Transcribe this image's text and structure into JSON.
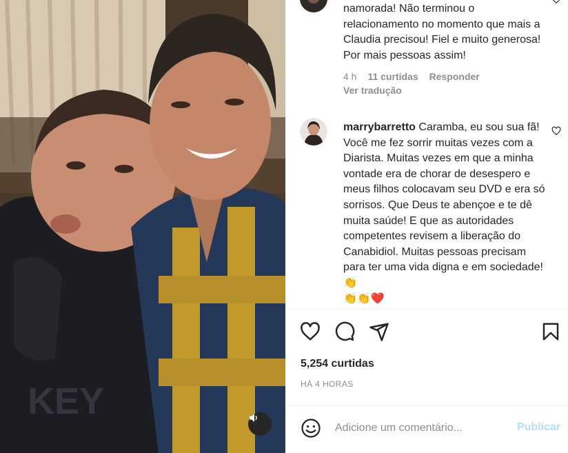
{
  "media": {
    "mute_icon": "speaker-icon"
  },
  "comments": [
    {
      "username": "",
      "text": "namorada! Não terminou o relacionamento no momento que mais a Claudia precisou! Fiel e muito generosa! Por mais pessoas assim!",
      "time": "4 h",
      "likes": "11 curtidas",
      "reply": "Responder",
      "translate": "Ver tradução"
    },
    {
      "username": "marrybarretto",
      "text": "Caramba, eu sou sua fã! Você me fez sorrir muitas vezes com a Diarista. Muitas vezes em que a minha vontade era de chorar de desespero e meus filhos colocavam seu DVD e era só sorrisos. Que Deus te abençoe e te dê muita saúde! E que as autoridades competentes revisem a liberação do Canabidiol. Muitas pessoas precisam para ter uma vida digna e em sociedade! 👏",
      "emojis": "👏👏❤️"
    }
  ],
  "post": {
    "likes": "5,254 curtidas",
    "time": "HÁ 4 HORAS"
  },
  "add_comment": {
    "placeholder": "Adicione um comentário...",
    "publish": "Publicar"
  },
  "colors": {
    "text": "#262626",
    "muted": "#8e8e8e",
    "publish_disabled": "#b2dffc",
    "heart_red": "#ed4956"
  }
}
